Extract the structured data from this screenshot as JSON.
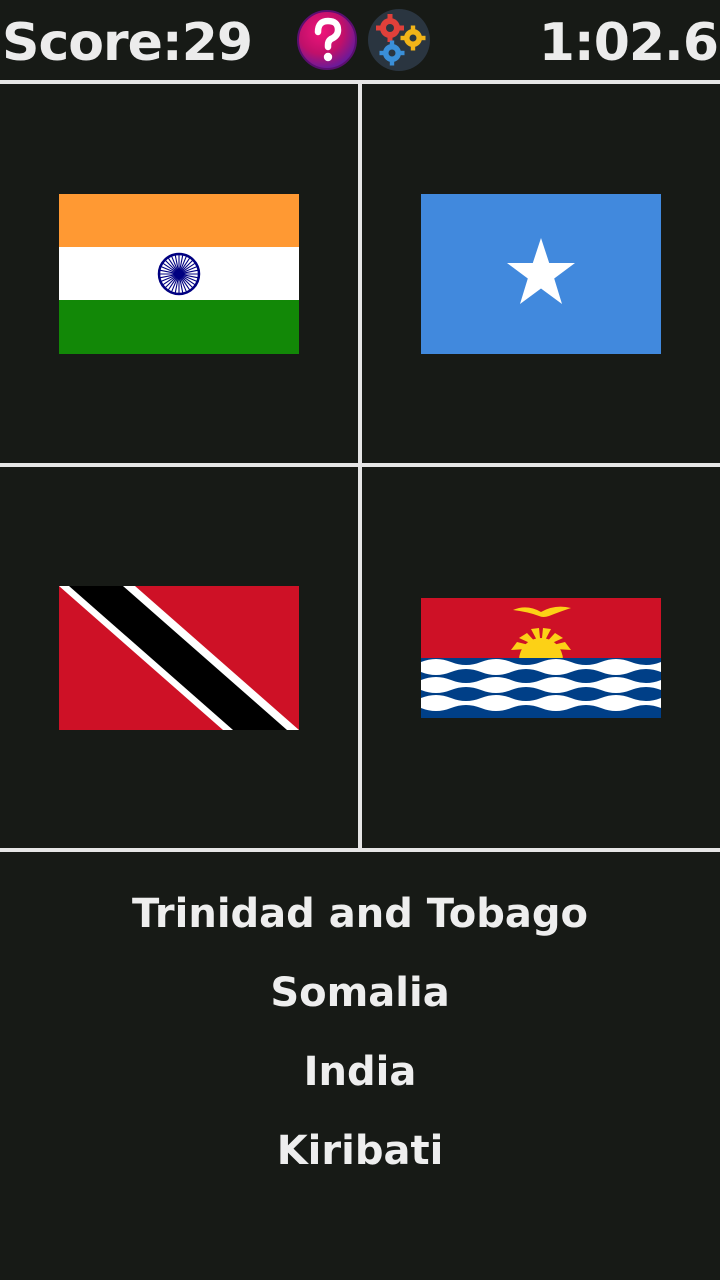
{
  "header": {
    "score_text": "Score:29",
    "timer_text": "1:02.6",
    "help_icon": "question-mark-icon",
    "settings_icon": "gears-icon"
  },
  "flags": [
    {
      "country_icon": "flag-india-icon"
    },
    {
      "country_icon": "flag-somalia-icon"
    },
    {
      "country_icon": "flag-trinidad-and-tobago-icon"
    },
    {
      "country_icon": "flag-kiribati-icon"
    }
  ],
  "answers": [
    "Trinidad and Tobago",
    "Somalia",
    "India",
    "Kiribati"
  ],
  "colors": {
    "background": "#171a16",
    "grid_lines": "#e6e6e6",
    "text": "#eeeeee"
  }
}
